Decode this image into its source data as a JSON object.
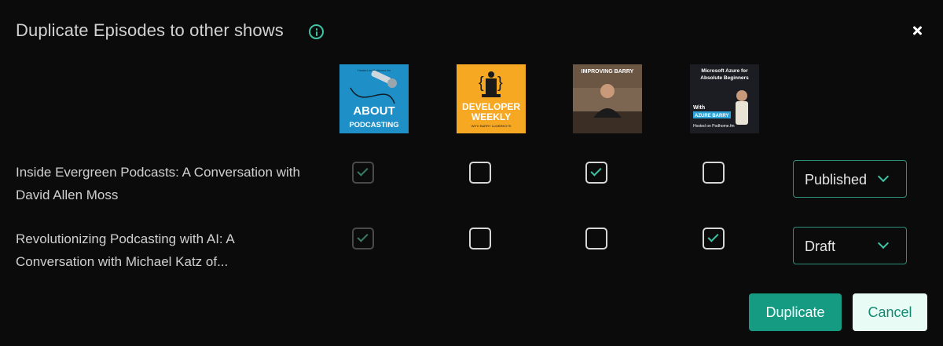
{
  "dialog": {
    "title": "Duplicate Episodes to other shows",
    "close_icon": "close-icon",
    "info_icon": "info-icon"
  },
  "shows": [
    {
      "name": "About Podcasting",
      "cover": {
        "top_text": "Hosted on Podhome.fm",
        "line1": "ABOUT",
        "line2": "PODCASTING",
        "bg": "#1e8fc7"
      }
    },
    {
      "name": "Developer Weekly",
      "cover": {
        "line1": "DEVELOPER",
        "line2": "WEEKLY",
        "line3": "WITH BARRY LUIJBREGTS",
        "bg": "#f7a823"
      }
    },
    {
      "name": "Improving Barry",
      "cover": {
        "line1": "IMPROVING BARRY",
        "bg": "#6b5644"
      }
    },
    {
      "name": "Microsoft Azure for Absolute Beginners",
      "cover": {
        "line1": "Microsoft Azure for",
        "line2": "Absolute Beginners",
        "line3": "With",
        "line4": "AZURE BARRY",
        "line5": "Hosted on Podhome.fm",
        "bg": "#1c1d22"
      }
    }
  ],
  "episodes": [
    {
      "title": "Inside Evergreen Podcasts: A Conversation with David Allen Moss",
      "checks": [
        {
          "checked": true,
          "disabled": true
        },
        {
          "checked": false,
          "disabled": false
        },
        {
          "checked": true,
          "disabled": false
        },
        {
          "checked": false,
          "disabled": false
        }
      ],
      "status": "Published"
    },
    {
      "title": "Revolutionizing Podcasting with AI: A Conversation with Michael Katz of...",
      "checks": [
        {
          "checked": true,
          "disabled": true
        },
        {
          "checked": false,
          "disabled": false
        },
        {
          "checked": false,
          "disabled": false
        },
        {
          "checked": true,
          "disabled": false
        }
      ],
      "status": "Draft"
    }
  ],
  "actions": {
    "duplicate_label": "Duplicate",
    "cancel_label": "Cancel"
  },
  "colors": {
    "accent": "#149b82",
    "accent_light": "#3ec3a4",
    "background": "#0b0b0c"
  }
}
